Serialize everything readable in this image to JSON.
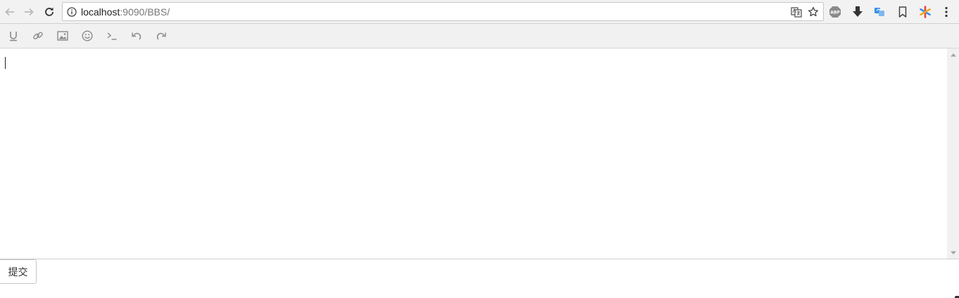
{
  "browser": {
    "url_host": "localhost",
    "url_path": ":9090/BBS/",
    "icons": {
      "back": "back-arrow-icon",
      "forward": "forward-arrow-icon",
      "reload": "reload-icon",
      "info": "info-icon",
      "translate": "translate-icon",
      "bookmark_star": "star-icon",
      "extensions": [
        "adblock-plus-icon",
        "download-icon",
        "sync-extension-icon",
        "bookmark-icon",
        "asterisk-extension-icon",
        "menu-icon"
      ]
    },
    "abp_label": "ABP"
  },
  "toolbar": {
    "buttons": [
      {
        "name": "underline",
        "icon": "underline-icon"
      },
      {
        "name": "link",
        "icon": "link-icon"
      },
      {
        "name": "image",
        "icon": "image-icon"
      },
      {
        "name": "emoji",
        "icon": "emoji-icon"
      },
      {
        "name": "code",
        "icon": "terminal-icon"
      },
      {
        "name": "undo",
        "icon": "undo-icon"
      },
      {
        "name": "redo",
        "icon": "redo-icon"
      }
    ]
  },
  "editor": {
    "content": ""
  },
  "form": {
    "submit_label": "提交"
  },
  "colors": {
    "toolbar_bg": "#f1f1f1",
    "icon_gray": "#8a8a8a",
    "extension_blue": "#3a8ee6",
    "extension_red": "#e8453c"
  }
}
